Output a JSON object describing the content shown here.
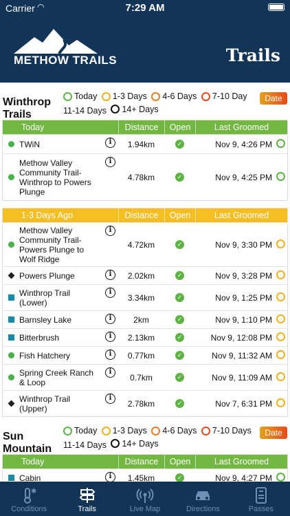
{
  "status": {
    "carrier": "Carrier",
    "time": "7:29 AM"
  },
  "header": {
    "logo_text": "METHOW TRAILS",
    "title": "Trails"
  },
  "legend": {
    "today": "Today",
    "d1_3": "1-3 Days",
    "d4_6": "4-6 Days",
    "d7_10": "7-10 Day",
    "d11_14": "11-14 Days",
    "d14plus": "14+ Days",
    "date_button": "Date",
    "colors": {
      "today": "#5cb543",
      "d1_3": "#f0b21c",
      "d4_6": "#e67e22",
      "d7_10": "#e04a1f",
      "d11_14": "#5cb543",
      "d14plus": "#111111"
    }
  },
  "legend2": {
    "d7_10": "7-10 Days"
  },
  "columns": {
    "distance": "Distance",
    "open": "Open",
    "groomed": "Last Groomed"
  },
  "winthrop": {
    "title": "Winthrop Trails",
    "group1": {
      "header": "Today",
      "rows": [
        {
          "name": "TWiN",
          "dist": "1.94km",
          "groomed": "Nov 9, 4:26 PM"
        },
        {
          "name": "Methow Valley Community Trail-Winthrop to Powers Plunge",
          "dist": "4.78km",
          "groomed": "Nov 9, 4:25 PM"
        }
      ]
    },
    "group2": {
      "header": "1-3 Days Ago",
      "rows": [
        {
          "name": "Methow Valley Community Trail-Powers Plunge to Wolf Ridge",
          "dist": "4.72km",
          "groomed": "Nov 9, 3:30 PM"
        },
        {
          "name": "Powers Plunge",
          "dist": "2.02km",
          "groomed": "Nov 9, 3:28 PM"
        },
        {
          "name": "Winthrop Trail (Lower)",
          "dist": "3.34km",
          "groomed": "Nov 9, 1:25 PM"
        },
        {
          "name": "Barnsley Lake",
          "dist": "2km",
          "groomed": "Nov 9, 1:10 PM"
        },
        {
          "name": "Bitterbrush",
          "dist": "2.13km",
          "groomed": "Nov 9, 12:08 PM"
        },
        {
          "name": "Fish Hatchery",
          "dist": "0.77km",
          "groomed": "Nov 9, 11:32 AM"
        },
        {
          "name": "Spring Creek Ranch & Loop",
          "dist": "0.7km",
          "groomed": "Nov 9, 11:09 AM"
        },
        {
          "name": "Winthrop Trail (Upper)",
          "dist": "2.78km",
          "groomed": "Nov 7, 6:31 PM"
        }
      ]
    }
  },
  "sun": {
    "title": "Sun Mountain",
    "group1": {
      "header": "Today",
      "rows": [
        {
          "name": "Cabin",
          "dist": "1.45km",
          "groomed": "Nov 9, 4:27 PM"
        }
      ]
    }
  },
  "tabs": {
    "conditions": "Conditions",
    "trails": "Trails",
    "live_map": "Live Map",
    "directions": "Directions",
    "passes": "Passes"
  }
}
